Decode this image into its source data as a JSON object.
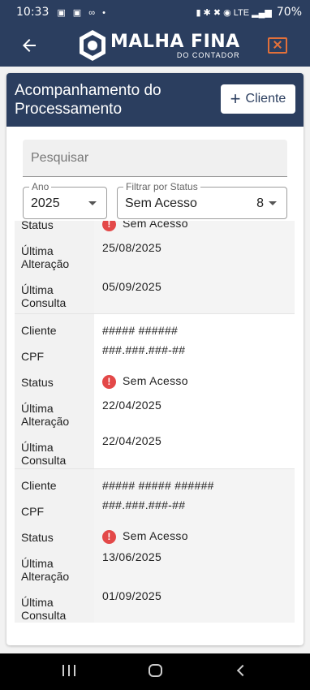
{
  "status_bar": {
    "time": "10:33",
    "left_icons": "▣ ▣ ∞ •",
    "right_icons": "▮ ✱ ✖ ◉ LTE ▂▄▆",
    "battery": "70%"
  },
  "app_bar": {
    "logo_main": "MALHA FINA",
    "logo_sub": "DO CONTADOR"
  },
  "card": {
    "title": "Acompanhamento do Processamento",
    "add_button_label": "Cliente"
  },
  "search": {
    "placeholder": "Pesquisar",
    "value": ""
  },
  "filters": {
    "year_label": "Ano",
    "year_value": "2025",
    "status_label": "Filtrar por Status",
    "status_value": "Sem Acesso",
    "status_count": "8"
  },
  "field_labels": {
    "cliente": "Cliente",
    "cpf": "CPF",
    "status": "Status",
    "ultima_alteracao": "Última Alteração",
    "ultima_consulta": "Última Consulta"
  },
  "records": [
    {
      "status": "Sem Acesso",
      "ultima_alteracao": "25/08/2025",
      "ultima_consulta": "05/09/2025"
    },
    {
      "cliente": "##### ######",
      "cpf": "###.###.###-##",
      "status": "Sem Acesso",
      "ultima_alteracao": "22/04/2025",
      "ultima_consulta": "22/04/2025"
    },
    {
      "cliente": "##### ##### ######",
      "cpf": "###.###.###-##",
      "status": "Sem Acesso",
      "ultima_alteracao": "13/06/2025",
      "ultima_consulta": "01/09/2025"
    }
  ],
  "colors": {
    "primary": "#2b3e5f",
    "accent": "#e2703a",
    "status_error": "#e34848"
  }
}
